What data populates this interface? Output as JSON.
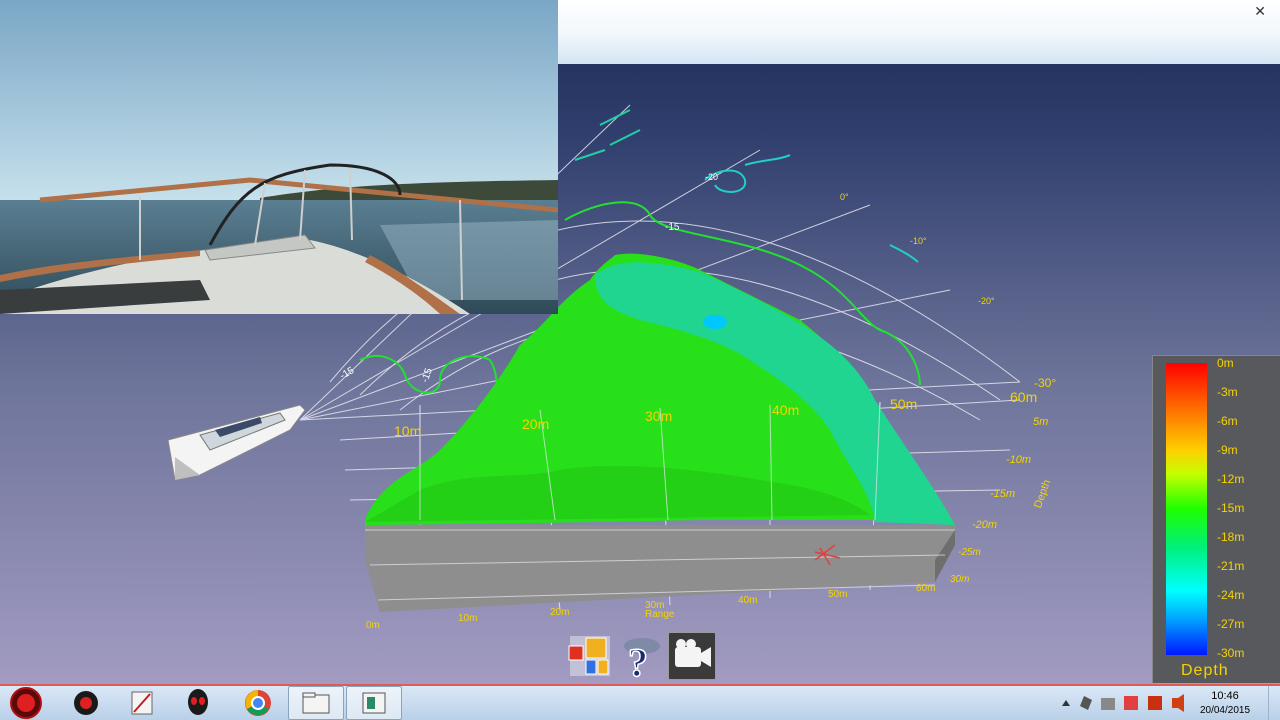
{
  "window": {
    "close_glyph": "✕"
  },
  "grid": {
    "range_ticks": [
      "10m",
      "20m",
      "30m",
      "40m",
      "50m",
      "60m"
    ],
    "front_range_ticks": [
      "0m",
      "10m",
      "20m",
      "30m",
      "40m",
      "50m",
      "60m"
    ],
    "depth_ticks": [
      "5m",
      "-10m",
      "-15m",
      "-20m",
      "-25m",
      "30m"
    ],
    "angle_ticks": [
      "0°",
      "-10°",
      "-20°",
      "-30°"
    ],
    "depth_axis_label": "Depth",
    "range_axis_label": "Range",
    "contour_labels": [
      "-15",
      "-15",
      "-15",
      "-20"
    ]
  },
  "legend": {
    "title": "Depth",
    "ticks": [
      "0m",
      "-3m",
      "-6m",
      "-9m",
      "-12m",
      "-15m",
      "-18m",
      "-21m",
      "-24m",
      "-27m",
      "-30m"
    ],
    "color_top": "#ff0000",
    "color_mid": "#1eff00",
    "color_low": "#00ffff",
    "color_bottom": "#0018ff"
  },
  "toolbar": {
    "display_icon": "display-settings-icon",
    "help_icon": "help-icon",
    "camera_icon": "camera-icon"
  },
  "taskbar": {
    "start_icon": "start-orb-icon",
    "apps": [
      "sonar-app-icon",
      "pen-tool-icon",
      "alien-app-icon",
      "chrome-icon",
      "file-explorer-icon",
      "sonar-window-icon"
    ],
    "tray": {
      "time": "10:46",
      "date": "20/04/2015"
    }
  },
  "colors": {
    "seafloor_green": "#27e01a",
    "seafloor_teal": "#1fd590",
    "grid_line": "#e8e8f0",
    "label_yellow": "#f4d400",
    "contour": "#20e030"
  }
}
